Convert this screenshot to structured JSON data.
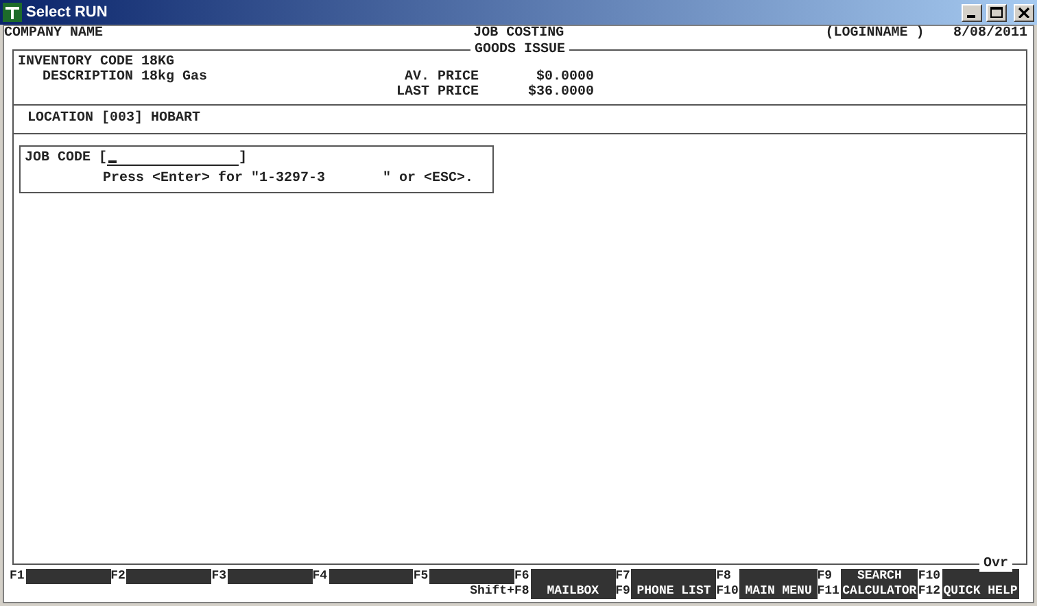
{
  "window": {
    "title": "Select RUN"
  },
  "header": {
    "company": "COMPANY NAME",
    "module": "JOB COSTING",
    "user": "(LOGINNAME )",
    "date": "8/08/2011"
  },
  "panel": {
    "title": "GOODS ISSUE",
    "status": "Ovr"
  },
  "item": {
    "fields": [
      {
        "label": "INVENTORY CODE",
        "value": "18KG"
      },
      {
        "label": "DESCRIPTION",
        "value": "18kg Gas"
      }
    ],
    "prices": [
      {
        "label": "AV. PRICE",
        "value": "$0.0000"
      },
      {
        "label": "LAST PRICE",
        "value": "$36.0000"
      }
    ]
  },
  "location": {
    "label": "LOCATION",
    "code": "[003]",
    "name": "HOBART"
  },
  "job_code": {
    "label": "JOB CODE",
    "open": "[",
    "close": "]",
    "prompt": "Press <Enter> for \"1-3297-3       \" or <ESC>."
  },
  "shift_prefix": "Shift+",
  "function_keys": [
    {
      "key": "F1"
    },
    {
      "key": "F2"
    },
    {
      "key": "F3"
    },
    {
      "key": "F4"
    },
    {
      "key": "F5"
    },
    {
      "key": "F6",
      "shift_key": "F8",
      "shift_label": "MAILBOX"
    },
    {
      "key": "F7",
      "shift_key": "F9",
      "shift_label": "PHONE LIST"
    },
    {
      "key": "F8",
      "shift_key": "F10",
      "shift_label": "MAIN MENU"
    },
    {
      "key": "F9",
      "label": "SEARCH",
      "shift_key": "F11",
      "shift_label": "CALCULATOR"
    },
    {
      "key": "F10",
      "shift_key": "F12",
      "shift_label": "QUICK HELP"
    }
  ]
}
